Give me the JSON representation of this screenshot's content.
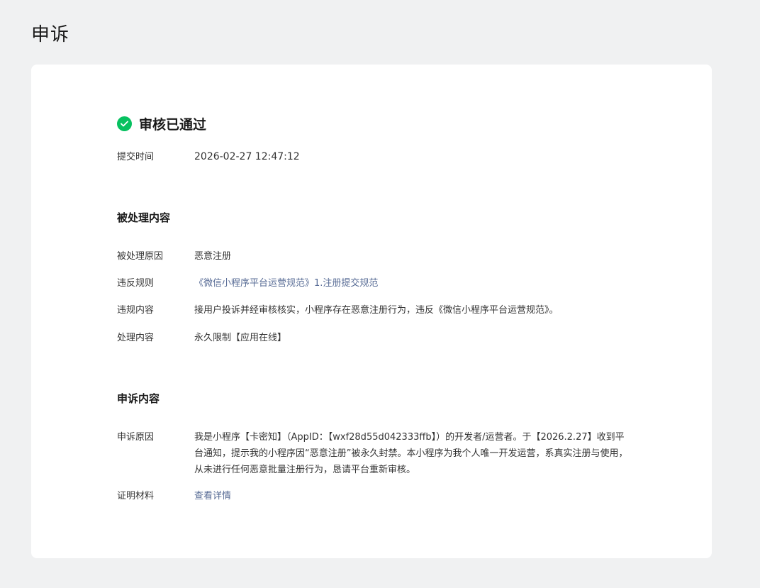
{
  "page": {
    "title": "申诉"
  },
  "status": {
    "text": "审核已通过",
    "icon": "check-circle-icon",
    "color": "#07c160"
  },
  "submit": {
    "label": "提交时间",
    "value": "2026-02-27 12:47:12"
  },
  "handled": {
    "section_title": "被处理内容",
    "reason_label": "被处理原因",
    "reason_value": "恶意注册",
    "rule_label": "违反规则",
    "rule_value": "《微信小程序平台运营规范》1.注册提交规范",
    "content_label": "违规内容",
    "content_value": "接用户投诉并经审核核实，小程序存在恶意注册行为，违反《微信小程序平台运营规范》。",
    "action_label": "处理内容",
    "action_value": "永久限制【应用在线】"
  },
  "appeal": {
    "section_title": "申诉内容",
    "reason_label": "申诉原因",
    "reason_value": "我是小程序【卡密知】（AppID：【wxf28d55d042333ffb】）的开发者/运营者。于【2026.2.27】收到平台通知，提示我的小程序因“恶意注册”被永久封禁。本小程序为我个人唯一开发运营，系真实注册与使用，从未进行任何恶意批量注册行为，恳请平台重新审核。",
    "proof_label": "证明材料",
    "proof_link": "查看详情"
  },
  "colors": {
    "link": "#576b95",
    "success": "#07c160",
    "background": "#f0f1f2"
  }
}
